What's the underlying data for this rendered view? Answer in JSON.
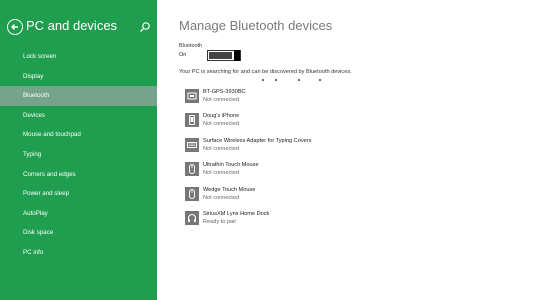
{
  "sidebar": {
    "title": "PC and devices",
    "items": [
      {
        "label": "Lock screen",
        "selected": false
      },
      {
        "label": "Display",
        "selected": false
      },
      {
        "label": "Bluetooth",
        "selected": true
      },
      {
        "label": "Devices",
        "selected": false
      },
      {
        "label": "Mouse and touchpad",
        "selected": false
      },
      {
        "label": "Typing",
        "selected": false
      },
      {
        "label": "Corners and edges",
        "selected": false
      },
      {
        "label": "Power and sleep",
        "selected": false
      },
      {
        "label": "AutoPlay",
        "selected": false
      },
      {
        "label": "Disk space",
        "selected": false
      },
      {
        "label": "PC info",
        "selected": false
      }
    ]
  },
  "main": {
    "title": "Manage Bluetooth devices",
    "bluetooth_label": "Bluetooth",
    "bluetooth_state": "On",
    "searching_text": "Your PC is searching for and can be discovered by Bluetooth devices.",
    "devices": [
      {
        "name": "BT-GPS-3930BC",
        "status": "Not connected",
        "icon": "gps-device-icon"
      },
      {
        "name": "Doug's iPhone",
        "status": "Not connected",
        "icon": "phone-icon"
      },
      {
        "name": "Surface Wireless Adapter for Typing Covers",
        "status": "Not connected",
        "icon": "keyboard-icon"
      },
      {
        "name": "Ultrathin Touch Mouse",
        "status": "Not connected",
        "icon": "mouse-icon"
      },
      {
        "name": "Wedge Touch Mouse",
        "status": "Not connected",
        "icon": "mouse-icon"
      },
      {
        "name": "SiriusXM Lynx Home Dock",
        "status": "Ready to pair",
        "icon": "headphones-icon"
      }
    ]
  },
  "colors": {
    "sidebar_bg": "#1f9e4f",
    "selected_bg": "#8aa89a",
    "icon_bg": "#777777"
  }
}
